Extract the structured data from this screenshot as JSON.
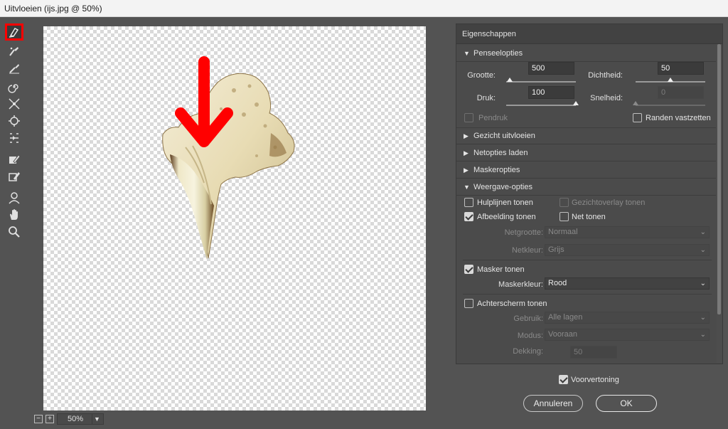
{
  "window": {
    "title": "Uitvloeien (ijs.jpg @ 50%)"
  },
  "tools": [
    {
      "name": "forward-warp-icon",
      "active": true
    },
    {
      "name": "reconstruct-icon"
    },
    {
      "name": "smooth-icon"
    },
    {
      "name": "twirl-icon"
    },
    {
      "name": "pucker-icon"
    },
    {
      "name": "bloat-icon"
    },
    {
      "name": "push-left-icon"
    },
    {
      "name": "freeze-mask-icon"
    },
    {
      "name": "thaw-mask-icon"
    },
    {
      "name": "face-tool-icon"
    },
    {
      "name": "hand-icon"
    },
    {
      "name": "zoom-icon"
    }
  ],
  "zoom": {
    "minus": "−",
    "plus": "+",
    "value": "50%"
  },
  "panel": {
    "title": "Eigenschappen",
    "brush": {
      "header": "Penseelopties",
      "size_label": "Grootte:",
      "size_value": "500",
      "size_frac": 0.05,
      "density_label": "Dichtheid:",
      "density_value": "50",
      "density_frac": 0.5,
      "pressure_label": "Druk:",
      "pressure_value": "100",
      "pressure_frac": 1.0,
      "rate_label": "Snelheid:",
      "rate_value": "0",
      "rate_frac": 0.0,
      "stylus_label": "Pendruk",
      "pin_edges_label": "Randen vastzetten"
    },
    "collapsed": [
      "Gezicht uitvloeien",
      "Netopties laden",
      "Maskeropties"
    ],
    "view": {
      "header": "Weergave-opties",
      "guides_label": "Hulplijnen tonen",
      "face_overlay_label": "Gezichtoverlay tonen",
      "image_label": "Afbeelding tonen",
      "mesh_label": "Net tonen",
      "mesh_size_label": "Netgrootte:",
      "mesh_size_value": "Normaal",
      "mesh_color_label": "Netkleur:",
      "mesh_color_value": "Grijs",
      "mask_label": "Masker tonen",
      "mask_color_label": "Maskerkleur:",
      "mask_color_value": "Rood",
      "backdrop_label": "Achterscherm tonen",
      "use_label": "Gebruik:",
      "use_value": "Alle lagen",
      "mode_label": "Modus:",
      "mode_value": "Vooraan",
      "opacity_label": "Dekking:",
      "opacity_value": "50"
    }
  },
  "footer": {
    "preview_label": "Voorvertoning",
    "cancel_label": "Annuleren",
    "ok_label": "OK"
  },
  "colors": {
    "highlight": "#ff0000",
    "panel": "#4b4b4b",
    "background": "#535353"
  }
}
